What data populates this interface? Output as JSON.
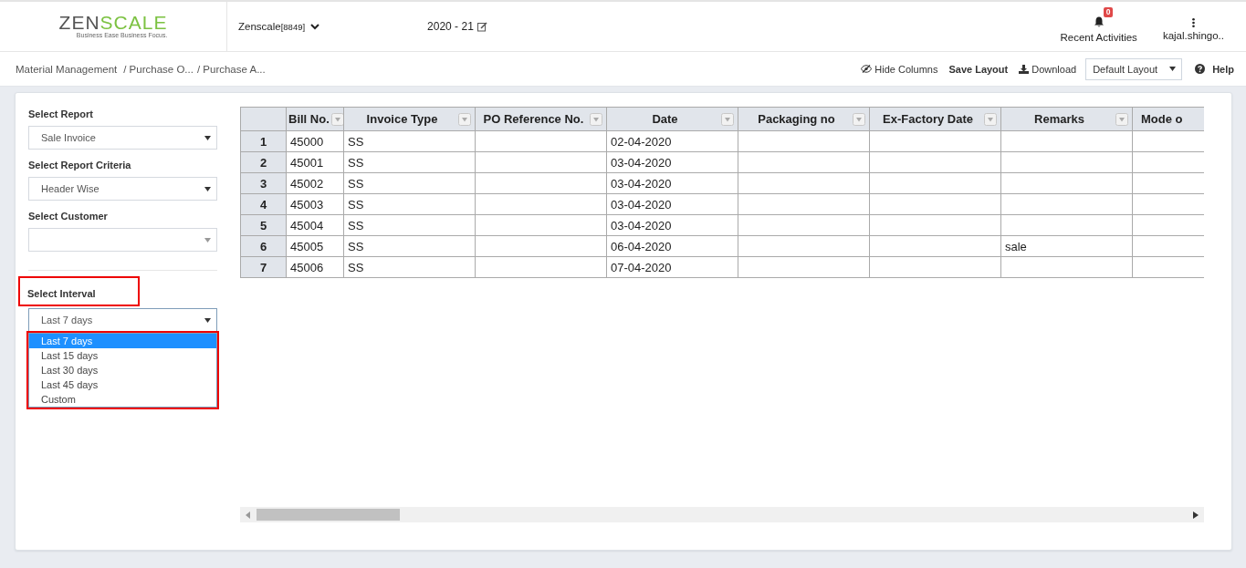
{
  "header": {
    "logo": {
      "dark_part": "ZEN",
      "green_part": "SCALE",
      "tagline": "Business Ease Business Focus."
    },
    "company": {
      "name": "Zenscale",
      "code": "[8849]"
    },
    "fiscal_year": "2020 - 21",
    "notifications": {
      "label": "Recent Activities",
      "count": "0"
    },
    "user": {
      "name": "kajal.shingo.."
    }
  },
  "breadcrumb": [
    "Material Management",
    "/ Purchase O...",
    "/ Purchase A..."
  ],
  "toolbar": {
    "hide_columns": "Hide Columns",
    "save_layout": "Save Layout",
    "download": "Download",
    "layout_select": "Default Layout",
    "help": "Help"
  },
  "filters": [
    {
      "label": "Select Report",
      "value": "Sale Invoice"
    },
    {
      "label": "Select Report Criteria",
      "value": "Header Wise"
    },
    {
      "label": "Select Customer",
      "divider_after": true
    },
    {
      "label": "Select Interval",
      "value": "Last 7 days",
      "open": true,
      "highlighted": true,
      "options": [
        {
          "label": "Last 7 days",
          "selected": true
        },
        {
          "label": "Last 15 days",
          "selected": false
        },
        {
          "label": "Last 30 days",
          "selected": false
        },
        {
          "label": "Last 45 days",
          "selected": false
        },
        {
          "label": "Custom",
          "selected": false
        }
      ]
    }
  ],
  "table": {
    "columns": [
      {
        "label": "Bill No."
      },
      {
        "label": "Invoice Type"
      },
      {
        "label": "PO Reference No."
      },
      {
        "label": "Date"
      },
      {
        "label": "Packaging no"
      },
      {
        "label": "Ex-Factory Date"
      },
      {
        "label": "Remarks"
      },
      {
        "label": "Mode o"
      }
    ],
    "rows": [
      {
        "number": "1",
        "cells": [
          "45000",
          "SS",
          "",
          "02-04-2020",
          "",
          "",
          "",
          ""
        ]
      },
      {
        "number": "2",
        "cells": [
          "45001",
          "SS",
          "",
          "03-04-2020",
          "",
          "",
          "",
          ""
        ]
      },
      {
        "number": "3",
        "cells": [
          "45002",
          "SS",
          "",
          "03-04-2020",
          "",
          "",
          "",
          ""
        ]
      },
      {
        "number": "4",
        "cells": [
          "45003",
          "SS",
          "",
          "03-04-2020",
          "",
          "",
          "",
          ""
        ]
      },
      {
        "number": "5",
        "cells": [
          "45004",
          "SS",
          "",
          "03-04-2020",
          "",
          "",
          "",
          ""
        ]
      },
      {
        "number": "6",
        "cells": [
          "45005",
          "SS",
          "",
          "06-04-2020",
          "",
          "",
          "sale",
          ""
        ]
      },
      {
        "number": "7",
        "cells": [
          "45006",
          "SS",
          "",
          "07-04-2020",
          "",
          "",
          "",
          ""
        ]
      }
    ]
  }
}
